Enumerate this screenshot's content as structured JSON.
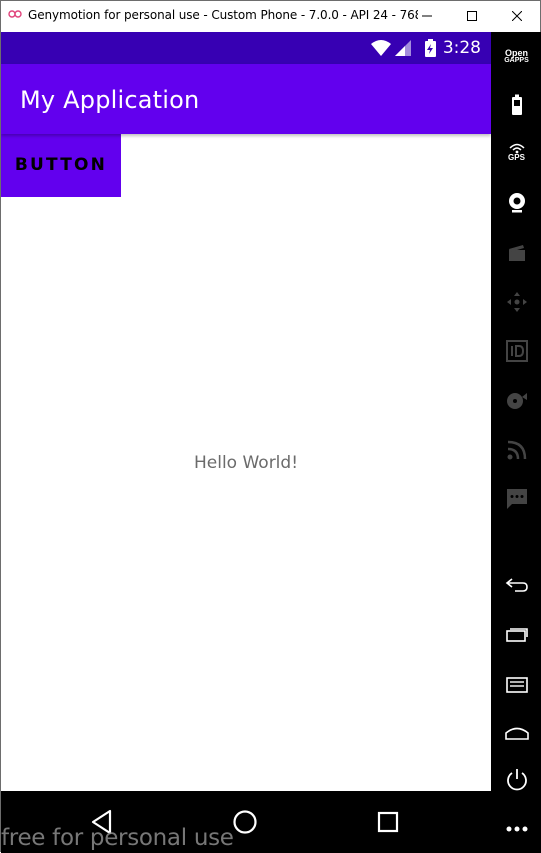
{
  "window": {
    "title": "Genymotion for personal use - Custom Phone - 7.0.0 - API 24 - 768x1...",
    "minimize_icon": "minimize-icon",
    "maximize_icon": "maximize-icon",
    "close_icon": "close-icon"
  },
  "statusbar": {
    "time": "3:28",
    "icons": [
      "wifi-icon",
      "signal-icon",
      "battery-charging-icon"
    ]
  },
  "app": {
    "title": "My Application",
    "button_label": "BUTTON",
    "hello_text": "Hello World!"
  },
  "navbar": {
    "icons": [
      "back-icon",
      "home-icon",
      "recents-icon"
    ]
  },
  "watermark": "free for personal use",
  "toolbar": {
    "opengapps_line1": "Open",
    "opengapps_line2": "GAPPS",
    "gps_label": "GPS",
    "items": [
      "opengapps-icon",
      "battery-icon",
      "gps-icon",
      "camera-icon",
      "media-icon",
      "move-icon",
      "id-icon",
      "disk-icon",
      "cast-icon",
      "sms-icon",
      "back-icon",
      "recents-icon",
      "menu-icon",
      "home-icon",
      "power-icon",
      "more-icon"
    ]
  },
  "colors": {
    "statusbar": "#3700b3",
    "appbar": "#6200ee",
    "button": "#6200ee",
    "toolbar": "#000000"
  }
}
